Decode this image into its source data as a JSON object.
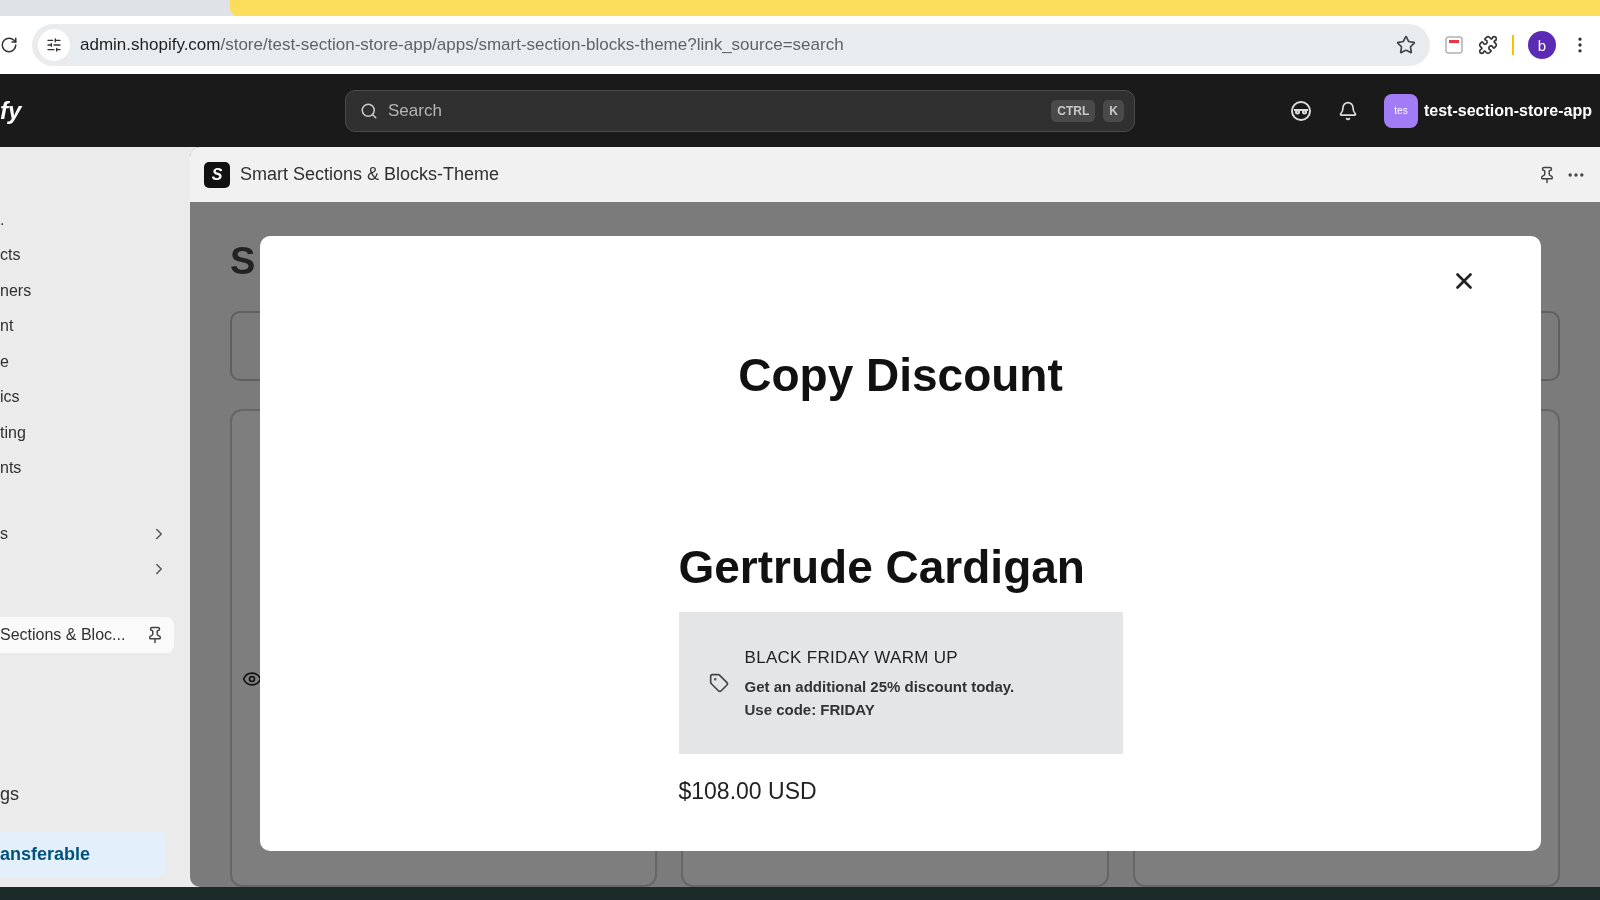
{
  "browser": {
    "url_host": "admin.shopify.com",
    "url_path": "/store/test-section-store-app/apps/smart-section-blocks-theme?link_source=search",
    "profile_initial": "b"
  },
  "topbar": {
    "logo_fragment": "fy",
    "search": {
      "placeholder": "Search"
    },
    "shortcut_keys": [
      "CTRL",
      "K"
    ],
    "store_badge": "tes",
    "store_name": "test-section-store-app"
  },
  "sidebar": {
    "items": [
      {
        "kind": "link",
        "label": ".",
        "selected": false
      },
      {
        "kind": "link",
        "label": "cts",
        "selected": false
      },
      {
        "kind": "link",
        "label": "ners",
        "selected": false
      },
      {
        "kind": "link",
        "label": "nt",
        "selected": false
      },
      {
        "kind": "link",
        "label": "e",
        "selected": false
      },
      {
        "kind": "link",
        "label": "ics",
        "selected": false
      },
      {
        "kind": "link",
        "label": "ting",
        "selected": false
      },
      {
        "kind": "link",
        "label": "nts",
        "selected": false
      },
      {
        "kind": "group",
        "label": "s",
        "selected": false
      },
      {
        "kind": "group",
        "selected": false
      },
      {
        "kind": "app",
        "label": "Sections & Bloc...",
        "selected": true
      }
    ],
    "footer_items": [
      {
        "label": "gs",
        "highlighted": false
      },
      {
        "label": "ansferable",
        "highlighted": true
      }
    ]
  },
  "app_header": {
    "logo_letter": "S",
    "title": "Smart Sections & Blocks-Theme"
  },
  "background_page": {
    "heading_fragment": "S"
  },
  "modal": {
    "title": "Copy Discount",
    "product": "Gertrude Cardigan",
    "discount": {
      "title": "BLACK FRIDAY WARM UP",
      "lines": [
        "Get an additional 25% discount today.",
        "Use code: FRIDAY"
      ]
    },
    "price": "$108.00 USD"
  }
}
